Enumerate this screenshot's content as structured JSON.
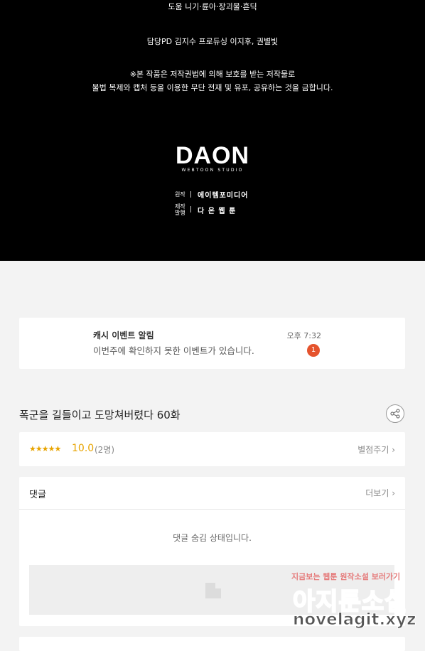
{
  "credits": {
    "help": "도움  니기·륜아·장괴물·흔딕",
    "staff": "담당PD  김지수    프로듀싱  이지후, 권별빛",
    "notice_line1": "※본 작품은 저작권법에 의해 보호를 받는 저작물로",
    "notice_line2": "불법 복제와 캡처 등을 이용한 무단 전재 및 유포, 공유하는 것을 금합니다.",
    "logo_main": "DAON",
    "logo_sub": "WEBTOON STUDIO",
    "original_label": "원작",
    "original_value": "에이템포미디어",
    "production_label": "제작 발행",
    "production_value": "다 온 웹 툰"
  },
  "notification": {
    "title": "캐시 이벤트 알림",
    "message": "이번주에 확인하지 못한 이벤트가 있습니다.",
    "time": "오후 7:32",
    "badge_count": "1"
  },
  "episode": {
    "title": "폭군을 길들이고 도망쳐버렸다 60화",
    "share_icon": "share-icon"
  },
  "rating": {
    "stars": "★★★★★",
    "score": "10.0",
    "count": "(2명)",
    "give_label": "별점주기 ›"
  },
  "comments": {
    "header": "댓글",
    "more_label": "더보기 ›",
    "hidden_message": "댓글 숨김 상태입니다."
  },
  "watermark": {
    "line1": "지금보는 웹툰 원작소설 보러가기",
    "line2": "아지툰소설",
    "line3": "novelagit.xyz"
  },
  "colors": {
    "accent_star": "#e8a400",
    "badge": "#e5532d"
  }
}
